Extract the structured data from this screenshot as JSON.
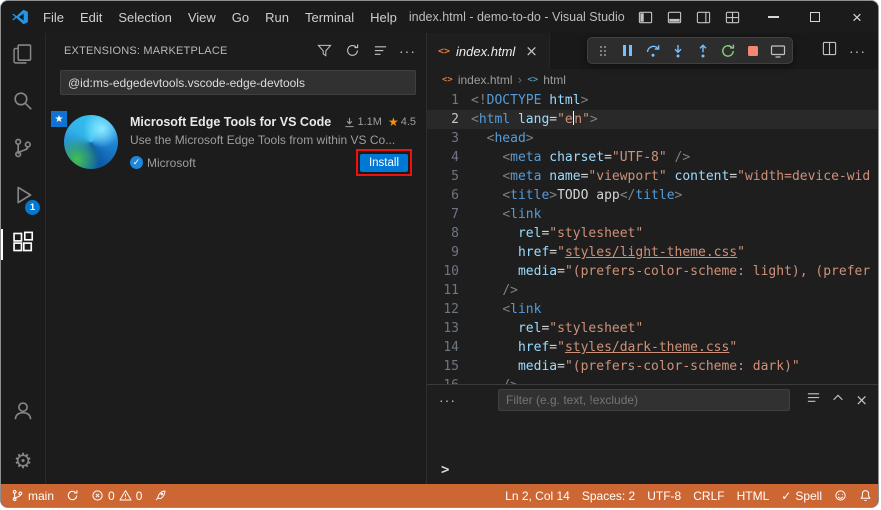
{
  "window": {
    "title": "index.html - demo-to-do - Visual Studio C...",
    "menus": [
      "File",
      "Edit",
      "Selection",
      "View",
      "Go",
      "Run",
      "Terminal",
      "Help"
    ]
  },
  "activity": {
    "debug_badge": "1"
  },
  "sidebar": {
    "header": "EXTENSIONS: MARKETPLACE",
    "search_value": "@id:ms-edgedevtools.vscode-edge-devtools",
    "extension": {
      "name": "Microsoft Edge Tools for VS Code",
      "installs": "1.1M",
      "rating": "4.5",
      "description": "Use the Microsoft Edge Tools from within VS Co...",
      "publisher": "Microsoft",
      "install_label": "Install"
    }
  },
  "editor": {
    "tab_label": "index.html",
    "breadcrumb_file": "index.html",
    "breadcrumb_symbol": "html",
    "lines": [
      {
        "n": "1",
        "t": [
          [
            "p",
            "<!"
          ],
          [
            "t",
            "DOCTYPE"
          ],
          [
            "a",
            " html"
          ],
          [
            "p",
            ">"
          ]
        ]
      },
      {
        "n": "2",
        "cur": true,
        "t": [
          [
            "p",
            "<"
          ],
          [
            "t",
            "html"
          ],
          [
            "d",
            " "
          ],
          [
            "a",
            "lang"
          ],
          [
            "d",
            "="
          ],
          [
            "s",
            "\"e"
          ],
          [
            "c",
            ""
          ],
          [
            "s",
            "n\""
          ],
          [
            "p",
            ">"
          ]
        ]
      },
      {
        "n": "3",
        "t": [
          [
            "d",
            "  "
          ],
          [
            "p",
            "<"
          ],
          [
            "t",
            "head"
          ],
          [
            "p",
            ">"
          ]
        ]
      },
      {
        "n": "4",
        "t": [
          [
            "d",
            "    "
          ],
          [
            "p",
            "<"
          ],
          [
            "t",
            "meta"
          ],
          [
            "d",
            " "
          ],
          [
            "a",
            "charset"
          ],
          [
            "d",
            "="
          ],
          [
            "s",
            "\"UTF-8\""
          ],
          [
            "d",
            " "
          ],
          [
            "p",
            "/>"
          ]
        ]
      },
      {
        "n": "5",
        "t": [
          [
            "d",
            "    "
          ],
          [
            "p",
            "<"
          ],
          [
            "t",
            "meta"
          ],
          [
            "d",
            " "
          ],
          [
            "a",
            "name"
          ],
          [
            "d",
            "="
          ],
          [
            "s",
            "\"viewport\""
          ],
          [
            "d",
            " "
          ],
          [
            "a",
            "content"
          ],
          [
            "d",
            "="
          ],
          [
            "s",
            "\"width=device-wid"
          ]
        ]
      },
      {
        "n": "6",
        "t": [
          [
            "d",
            "    "
          ],
          [
            "p",
            "<"
          ],
          [
            "t",
            "title"
          ],
          [
            "p",
            ">"
          ],
          [
            "d",
            "TODO app"
          ],
          [
            "p",
            "</"
          ],
          [
            "t",
            "title"
          ],
          [
            "p",
            ">"
          ]
        ]
      },
      {
        "n": "7",
        "t": [
          [
            "d",
            "    "
          ],
          [
            "p",
            "<"
          ],
          [
            "t",
            "link"
          ]
        ]
      },
      {
        "n": "8",
        "t": [
          [
            "d",
            "      "
          ],
          [
            "a",
            "rel"
          ],
          [
            "d",
            "="
          ],
          [
            "s",
            "\"stylesheet\""
          ]
        ]
      },
      {
        "n": "9",
        "t": [
          [
            "d",
            "      "
          ],
          [
            "a",
            "href"
          ],
          [
            "d",
            "="
          ],
          [
            "s",
            "\""
          ],
          [
            "u",
            "styles/light-theme.css"
          ],
          [
            "s",
            "\""
          ]
        ]
      },
      {
        "n": "10",
        "t": [
          [
            "d",
            "      "
          ],
          [
            "a",
            "media"
          ],
          [
            "d",
            "="
          ],
          [
            "s",
            "\"(prefers-color-scheme: light), (prefer"
          ]
        ]
      },
      {
        "n": "11",
        "t": [
          [
            "d",
            "    "
          ],
          [
            "p",
            "/>"
          ]
        ]
      },
      {
        "n": "12",
        "t": [
          [
            "d",
            "    "
          ],
          [
            "p",
            "<"
          ],
          [
            "t",
            "link"
          ]
        ]
      },
      {
        "n": "13",
        "t": [
          [
            "d",
            "      "
          ],
          [
            "a",
            "rel"
          ],
          [
            "d",
            "="
          ],
          [
            "s",
            "\"stylesheet\""
          ]
        ]
      },
      {
        "n": "14",
        "t": [
          [
            "d",
            "      "
          ],
          [
            "a",
            "href"
          ],
          [
            "d",
            "="
          ],
          [
            "s",
            "\""
          ],
          [
            "u",
            "styles/dark-theme.css"
          ],
          [
            "s",
            "\""
          ]
        ]
      },
      {
        "n": "15",
        "t": [
          [
            "d",
            "      "
          ],
          [
            "a",
            "media"
          ],
          [
            "d",
            "="
          ],
          [
            "s",
            "\"(prefers-color-scheme: dark)\""
          ]
        ]
      },
      {
        "n": "16",
        "t": [
          [
            "d",
            "    "
          ],
          [
            "p",
            "/>"
          ]
        ]
      }
    ]
  },
  "panel": {
    "filter_placeholder": "Filter (e.g. text, !exclude)",
    "prompt": ">"
  },
  "status": {
    "branch": "main",
    "errors": "0",
    "warnings": "0",
    "line_col": "Ln 2, Col 14",
    "indent": "Spaces: 2",
    "encoding": "UTF-8",
    "eol": "CRLF",
    "language": "HTML",
    "spell": "Spell"
  },
  "colors": {
    "accent": "#0078d4",
    "status_debug": "#cc6633",
    "annotation": "#ee1111"
  }
}
